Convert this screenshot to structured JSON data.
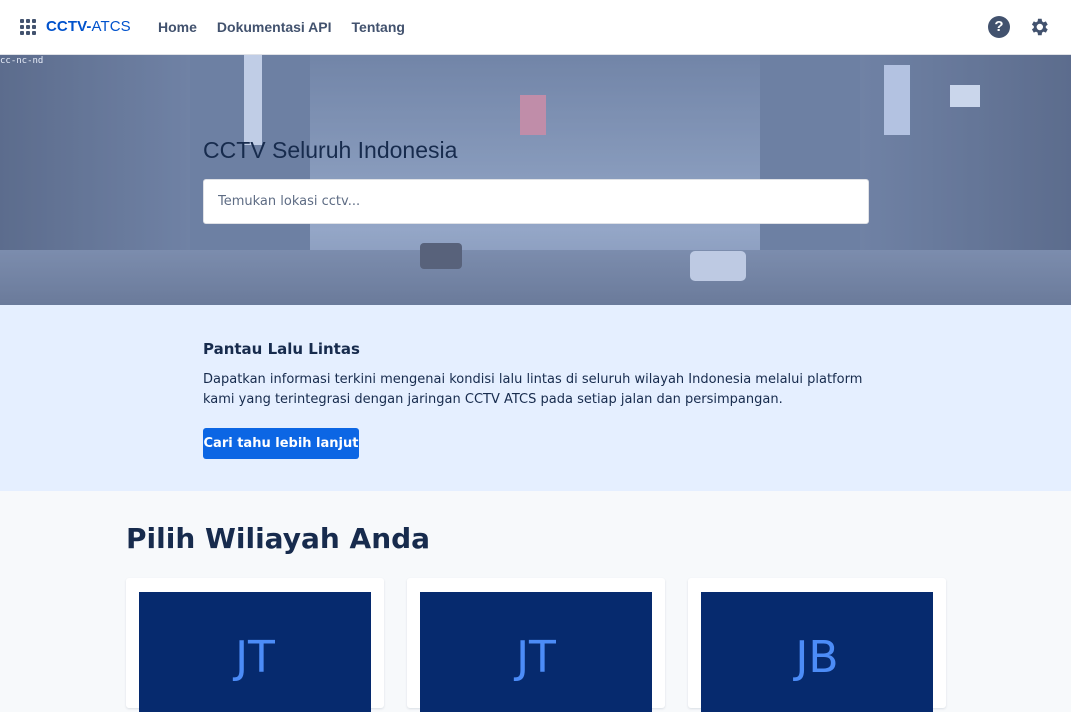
{
  "nav": {
    "brand_bold": "CCTV-",
    "brand_rest": "ATCS",
    "links": [
      "Home",
      "Dokumentasi API",
      "Tentang"
    ],
    "help_glyph": "?"
  },
  "hero": {
    "watermark": "cc-nc-nd",
    "title": "CCTV Seluruh Indonesia",
    "search_placeholder": "Temukan lokasi cctv..."
  },
  "info": {
    "title": "Pantau Lalu Lintas",
    "text": "Dapatkan informasi terkini mengenai kondisi lalu lintas di seluruh wilayah Indonesia melalui platform kami yang terintegrasi dengan jaringan CCTV ATCS pada setiap jalan dan persimpangan.",
    "button": "Cari tahu lebih lanjut"
  },
  "regions": {
    "title": "Pilih Wiliayah Anda",
    "cards": [
      "JT",
      "JT",
      "JB"
    ]
  },
  "colors": {
    "accent": "#0c66e4",
    "brand": "#0052cc",
    "card_bg": "#062a6e",
    "card_text": "#4c8cf7"
  }
}
